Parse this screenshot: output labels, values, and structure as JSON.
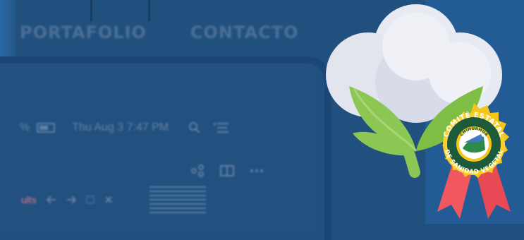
{
  "nav": {
    "items": [
      "PORTAFOLIO",
      "CONTACTO"
    ]
  },
  "status_bar": {
    "percent": "%",
    "datetime": "Thu Aug 3  7:47 PM"
  },
  "bottom_bar": {
    "label": "ults"
  },
  "seal": {
    "outer_top": "COMITÉ ESTATAL",
    "outer_bottom": "DE SANIDAD VEGETAL",
    "inner_top": "CHIHUAHUA"
  },
  "colors": {
    "background": "#21507f",
    "accent_panel": "#235b94",
    "nav_text": "#4b6f96",
    "cotton_boll": "#e6e8f1",
    "leaf": "#8cc653",
    "seal_gold": "#f5c518",
    "ribbon": "#f0575f"
  },
  "icons": [
    "battery-icon",
    "search-icon",
    "list-icon",
    "share-icon",
    "panel-icon",
    "more-icon",
    "back-arrow-icon",
    "forward-arrow-icon",
    "close-icon",
    "cotton-plant-icon",
    "award-seal-icon"
  ]
}
